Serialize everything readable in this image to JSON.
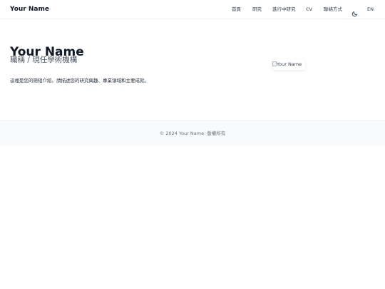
{
  "nav": {
    "brand": "Your Name",
    "items": [
      {
        "label": "首頁"
      },
      {
        "label": "研究"
      },
      {
        "label": "進行中研究"
      },
      {
        "label": "CV"
      },
      {
        "label": "聯絡方式"
      }
    ],
    "theme_icon": "moon-icon",
    "language_label": "EN"
  },
  "hero": {
    "name": "Your Name",
    "affiliation": "職稱 / 現任學術機構",
    "bio": "這裡是您的簡短介紹。請描述您的研究興趣、專業領域和主要成就。",
    "photo_alt": "Your Name",
    "photo_icon": "broken-image-icon"
  },
  "footer": {
    "copyright": "© 2024 Your Name. 版權所有"
  }
}
